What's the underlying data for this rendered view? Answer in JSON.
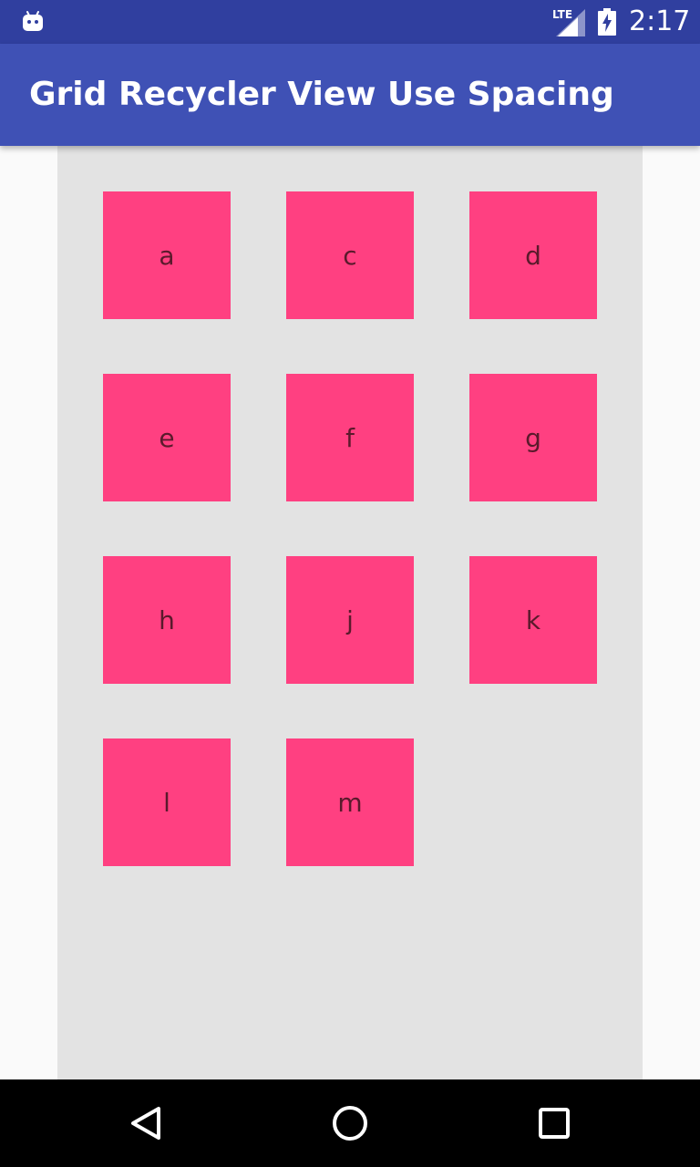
{
  "status_bar": {
    "network_label": "LTE",
    "time": "2:17",
    "icons": [
      "android-notification-icon",
      "signal-icon",
      "battery-charging-icon"
    ]
  },
  "app_bar": {
    "title": "Grid Recycler View Use Spacing",
    "color": "#3f51b5"
  },
  "grid": {
    "columns": 3,
    "item_color": "#ff4081",
    "background_color": "#e3e3e3",
    "items": [
      "a",
      "c",
      "d",
      "e",
      "f",
      "g",
      "h",
      "j",
      "k",
      "l",
      "m"
    ]
  },
  "nav_bar": {
    "buttons": [
      "back-icon",
      "home-icon",
      "recents-icon"
    ]
  }
}
